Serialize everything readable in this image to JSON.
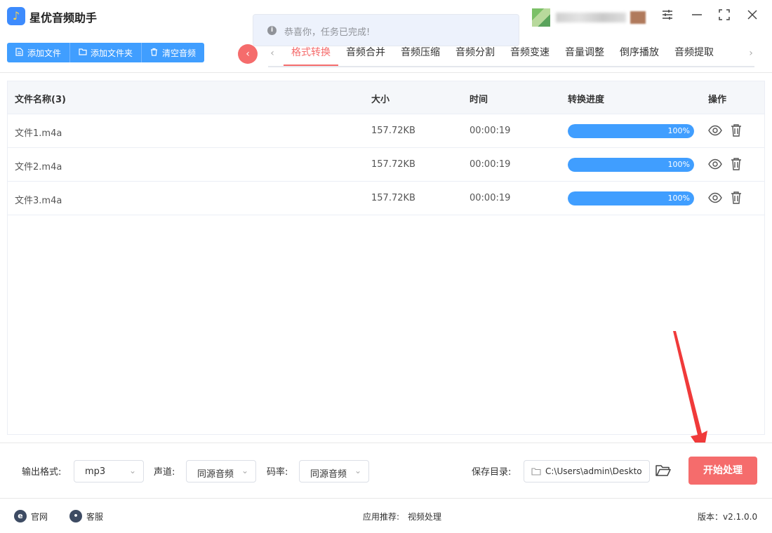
{
  "app": {
    "title": "星优音频助手",
    "logo_glyph": "♪"
  },
  "toast": {
    "icon": "i",
    "message": "恭喜你，任务已完成!"
  },
  "toolbar": {
    "add_file": "添加文件",
    "add_folder": "添加文件夹",
    "clear_audio": "清空音频"
  },
  "nav": {
    "collapse_glyph": "‹",
    "prev_glyph": "‹",
    "next_glyph": "›",
    "tabs": [
      "格式转换",
      "音频合并",
      "音频压缩",
      "音频分割",
      "音频变速",
      "音量调整",
      "倒序播放",
      "音频提取"
    ],
    "active_index": 0
  },
  "table": {
    "headers": {
      "name": "文件名称(3)",
      "size": "大小",
      "time": "时间",
      "progress": "转换进度",
      "actions": "操作"
    },
    "rows": [
      {
        "name": "文件1.m4a",
        "size": "157.72KB",
        "time": "00:00:19",
        "progress_label": "100%",
        "progress": 1.0
      },
      {
        "name": "文件2.m4a",
        "size": "157.72KB",
        "time": "00:00:19",
        "progress_label": "100%",
        "progress": 1.0
      },
      {
        "name": "文件3.m4a",
        "size": "157.72KB",
        "time": "00:00:19",
        "progress_label": "100%",
        "progress": 1.0
      }
    ]
  },
  "settings": {
    "output_format_label": "输出格式:",
    "output_format_value": "mp3",
    "channel_label": "声道:",
    "channel_value": "同源音频",
    "bitrate_label": "码率:",
    "bitrate_value": "同源音频",
    "save_dir_label": "保存目录:",
    "save_dir_value": "C:\\Users\\admin\\Deskto",
    "start_button": "开始处理"
  },
  "footer": {
    "website": "官网",
    "website_icon": "e",
    "support": "客服",
    "support_icon": "•",
    "recommend_label": "应用推荐:",
    "recommend_value": "视频处理",
    "version": "版本：v2.1.0.0"
  },
  "colors": {
    "primary": "#409eff",
    "accent": "#f56c6c",
    "annotation": "#f03a3a"
  }
}
